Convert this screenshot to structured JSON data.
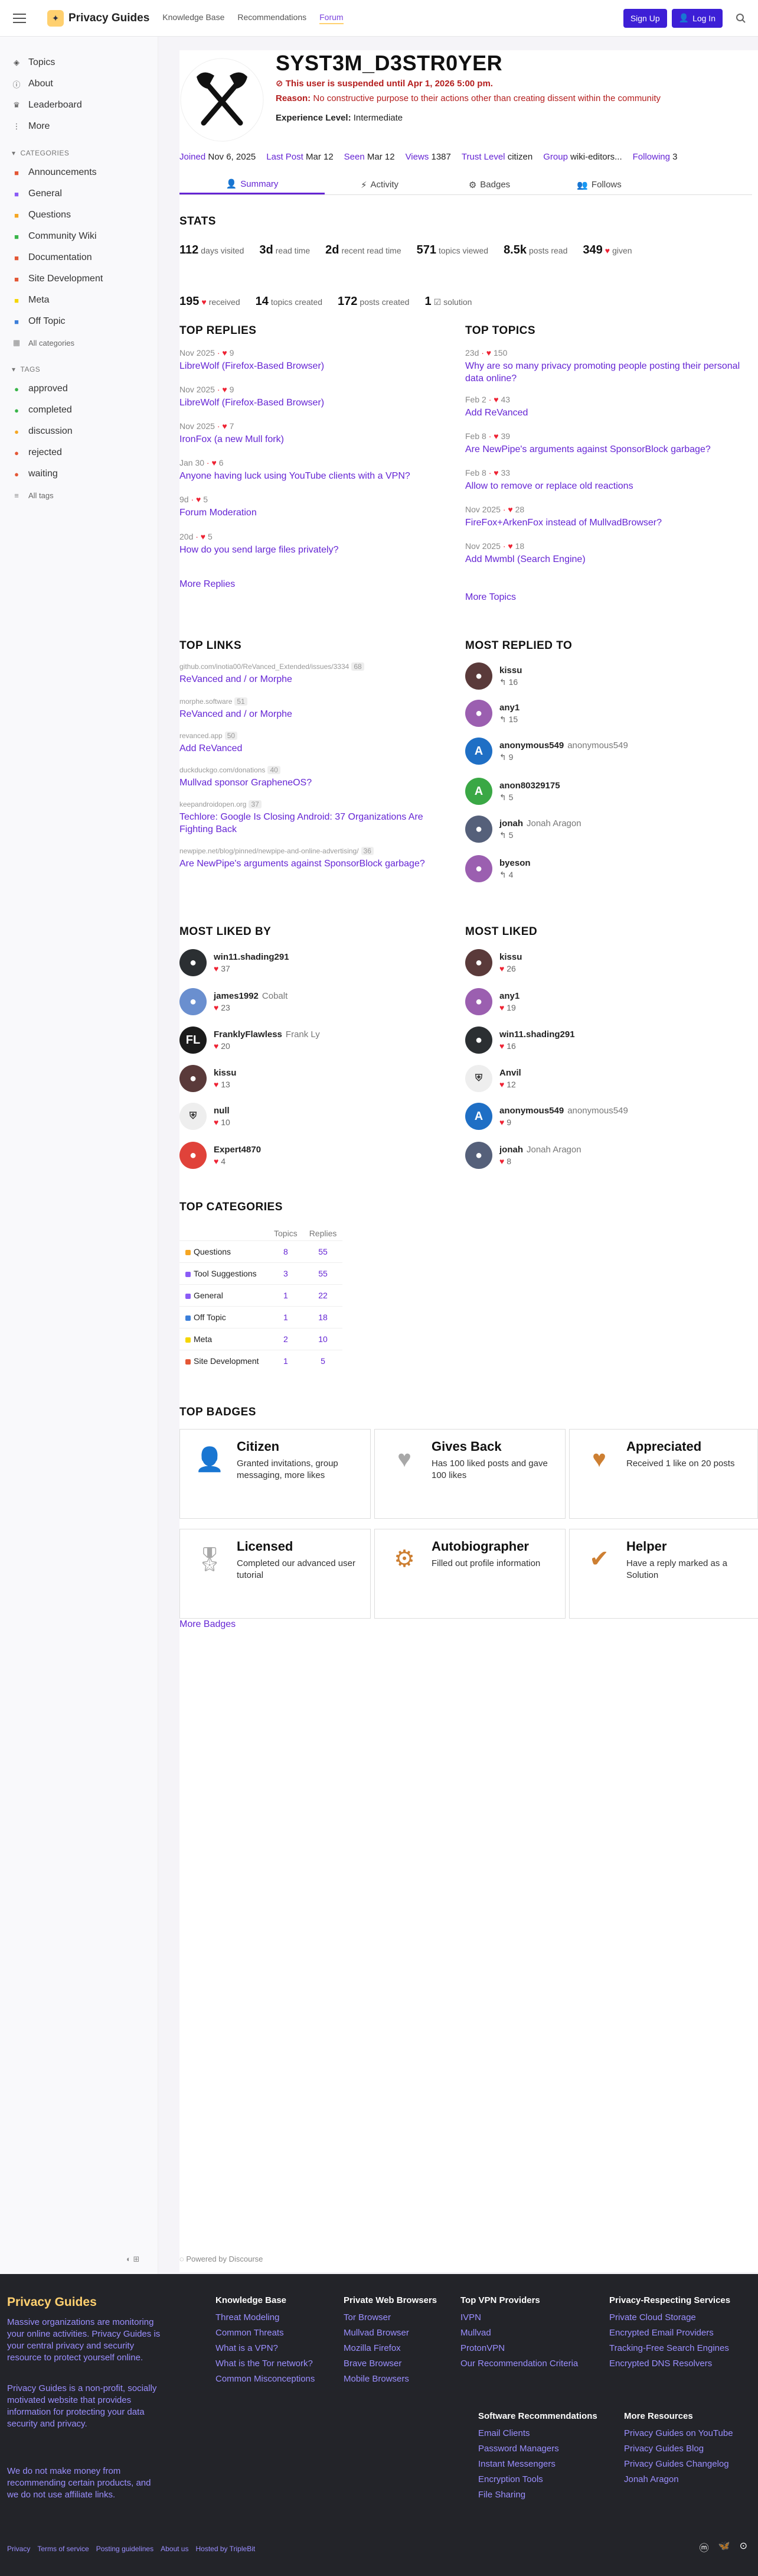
{
  "header": {
    "site_name": "Privacy Guides",
    "nav": [
      "Knowledge Base",
      "Recommendations",
      "Forum"
    ],
    "signup": "Sign Up",
    "login": "Log In"
  },
  "sidebar": {
    "items": [
      {
        "icon": "layer-icon",
        "label": "Topics"
      },
      {
        "icon": "info-icon",
        "label": "About"
      },
      {
        "icon": "trophy-icon",
        "label": "Leaderboard"
      },
      {
        "icon": "more-icon",
        "label": "More"
      }
    ],
    "categories_title": "CATEGORIES",
    "categories": [
      {
        "label": "Announcements",
        "color": "#e45735"
      },
      {
        "label": "General",
        "color": "#8b5cf6"
      },
      {
        "label": "Questions",
        "color": "#f5a623"
      },
      {
        "label": "Community Wiki",
        "color": "#3ab54a"
      },
      {
        "label": "Documentation",
        "color": "#e45735"
      },
      {
        "label": "Site Development",
        "color": "#e45735"
      },
      {
        "label": "Meta",
        "color": "#f5d600"
      },
      {
        "label": "Off Topic",
        "color": "#3c7fd9"
      },
      {
        "label": "All categories",
        "color": "#888888"
      }
    ],
    "tags_title": "TAGS",
    "tags": [
      {
        "label": "approved",
        "color": "#3ab54a"
      },
      {
        "label": "completed",
        "color": "#3ab54a"
      },
      {
        "label": "discussion",
        "color": "#f5a623"
      },
      {
        "label": "rejected",
        "color": "#e45735"
      },
      {
        "label": "waiting",
        "color": "#e45735"
      },
      {
        "label": "All tags",
        "color": "#888888"
      }
    ]
  },
  "profile": {
    "username": "SYST3M_D3STR0YER",
    "suspended": "This user is suspended until Apr 1, 2026 5:00 pm.",
    "reason_label": "Reason:",
    "reason": "No constructive purpose to their actions other than creating dissent within the community",
    "experience_label": "Experience Level:",
    "experience": "Intermediate",
    "meta": [
      {
        "k": "Joined",
        "v": "Nov 6, 2025"
      },
      {
        "k": "Last Post",
        "v": "Mar 12"
      },
      {
        "k": "Seen",
        "v": "Mar 12"
      },
      {
        "k": "Views",
        "v": "1387"
      },
      {
        "k": "Trust Level",
        "v": "citizen"
      },
      {
        "k": "Group",
        "v": "wiki-editors..."
      },
      {
        "k": "Following",
        "v": "3"
      }
    ]
  },
  "tabs": [
    "Summary",
    "Activity",
    "Badges",
    "Follows"
  ],
  "stats_title": "STATS",
  "stats": [
    {
      "n": "112",
      "l": "days visited"
    },
    {
      "n": "3d",
      "l": "read time"
    },
    {
      "n": "2d",
      "l": "recent read time"
    },
    {
      "n": "571",
      "l": "topics viewed"
    },
    {
      "n": "8.5k",
      "l": "posts read"
    },
    {
      "n": "349",
      "l": "given"
    },
    {
      "n": "195",
      "l": "received"
    },
    {
      "n": "14",
      "l": "topics created"
    },
    {
      "n": "172",
      "l": "posts created"
    },
    {
      "n": "1",
      "l": "solution"
    }
  ],
  "top_replies_title": "TOP REPLIES",
  "top_replies": [
    {
      "date": "Nov 2025",
      "likes": "9",
      "title": "LibreWolf (Firefox-Based Browser)"
    },
    {
      "date": "Nov 2025",
      "likes": "9",
      "title": "LibreWolf (Firefox-Based Browser)"
    },
    {
      "date": "Nov 2025",
      "likes": "7",
      "title": "IronFox (a new Mull fork)"
    },
    {
      "date": "Jan 30",
      "likes": "6",
      "title": "Anyone having luck using YouTube clients with a VPN?"
    },
    {
      "date": "9d",
      "likes": "5",
      "title": "Forum Moderation"
    },
    {
      "date": "20d",
      "likes": "5",
      "title": "How do you send large files privately?"
    }
  ],
  "more_replies": "More Replies",
  "top_topics_title": "TOP TOPICS",
  "top_topics": [
    {
      "date": "23d",
      "likes": "150",
      "title": "Why are so many privacy promoting people posting their personal data online?"
    },
    {
      "date": "Feb 2",
      "likes": "43",
      "title": "Add ReVanced"
    },
    {
      "date": "Feb 8",
      "likes": "39",
      "title": "Are NewPipe's arguments against SponsorBlock garbage?"
    },
    {
      "date": "Feb 8",
      "likes": "33",
      "title": "Allow to remove or replace old reactions"
    },
    {
      "date": "Nov 2025",
      "likes": "28",
      "title": "FireFox+ArkenFox instead of MullvadBrowser?"
    },
    {
      "date": "Nov 2025",
      "likes": "18",
      "title": "Add Mwmbl (Search Engine)"
    }
  ],
  "more_topics": "More Topics",
  "top_links_title": "TOP LINKS",
  "top_links": [
    {
      "domain": "github.com/inotia00/ReVanced_Extended/issues/3334",
      "count": "68",
      "title": "ReVanced and / or Morphe"
    },
    {
      "domain": "morphe.software",
      "count": "51",
      "title": "ReVanced and / or Morphe"
    },
    {
      "domain": "revanced.app",
      "count": "50",
      "title": "Add ReVanced"
    },
    {
      "domain": "duckduckgo.com/donations",
      "count": "40",
      "title": "Mullvad sponsor GrapheneOS?"
    },
    {
      "domain": "keepandroidopen.org",
      "count": "37",
      "title": "Techlore: Google Is Closing Android: 37 Organizations Are Fighting Back"
    },
    {
      "domain": "newpipe.net/blog/pinned/newpipe-and-online-advertising/",
      "count": "36",
      "title": "Are NewPipe's arguments against SponsorBlock garbage?"
    }
  ],
  "most_replied_title": "MOST REPLIED TO",
  "most_replied": [
    {
      "name": "kissu",
      "full": "",
      "count": "16",
      "color": "#5a3a3a",
      "init": ""
    },
    {
      "name": "any1",
      "full": "",
      "count": "15",
      "color": "#9b5fb0",
      "init": ""
    },
    {
      "name": "anonymous549",
      "full": "anonymous549",
      "count": "9",
      "color": "#1f6fc5",
      "init": "A"
    },
    {
      "name": "anon80329175",
      "full": "",
      "count": "5",
      "color": "#3aa845",
      "init": "A"
    },
    {
      "name": "jonah",
      "full": "Jonah Aragon",
      "count": "5",
      "color": "#55607a",
      "init": ""
    },
    {
      "name": "byeson",
      "full": "",
      "count": "4",
      "color": "#9b5fb0",
      "init": ""
    }
  ],
  "most_liked_by_title": "MOST LIKED BY",
  "most_liked_by": [
    {
      "name": "win11.shading291",
      "full": "",
      "count": "37",
      "color": "#2b2f32",
      "init": ""
    },
    {
      "name": "james1992",
      "full": "Cobalt",
      "count": "23",
      "color": "#6a8fcf",
      "init": ""
    },
    {
      "name": "FranklyFlawless",
      "full": "Frank Ly",
      "count": "20",
      "color": "#1b1b1b",
      "init": "FL"
    },
    {
      "name": "kissu",
      "full": "",
      "count": "13",
      "color": "#5a3a3a",
      "init": ""
    },
    {
      "name": "null",
      "full": "",
      "count": "10",
      "color": "#eeeeee",
      "init": ""
    },
    {
      "name": "Expert4870",
      "full": "",
      "count": "4",
      "color": "#e0423a",
      "init": ""
    }
  ],
  "most_liked_title": "MOST LIKED",
  "most_liked": [
    {
      "name": "kissu",
      "full": "",
      "count": "26",
      "color": "#5a3a3a",
      "init": ""
    },
    {
      "name": "any1",
      "full": "",
      "count": "19",
      "color": "#9b5fb0",
      "init": ""
    },
    {
      "name": "win11.shading291",
      "full": "",
      "count": "16",
      "color": "#2b2f32",
      "init": ""
    },
    {
      "name": "Anvil",
      "full": "",
      "count": "12",
      "color": "#eeeeee",
      "init": ""
    },
    {
      "name": "anonymous549",
      "full": "anonymous549",
      "count": "9",
      "color": "#1f6fc5",
      "init": "A"
    },
    {
      "name": "jonah",
      "full": "Jonah Aragon",
      "count": "8",
      "color": "#55607a",
      "init": ""
    }
  ],
  "top_categories_title": "TOP CATEGORIES",
  "top_categories_headers": [
    "Topics",
    "Replies"
  ],
  "top_categories": [
    {
      "name": "Questions",
      "topics": "8",
      "replies": "55",
      "color": "#f5a623"
    },
    {
      "name": "Tool Suggestions",
      "topics": "3",
      "replies": "55",
      "color": "#8b5cf6"
    },
    {
      "name": "General",
      "topics": "1",
      "replies": "22",
      "color": "#8b5cf6"
    },
    {
      "name": "Off Topic",
      "topics": "1",
      "replies": "18",
      "color": "#3c7fd9"
    },
    {
      "name": "Meta",
      "topics": "2",
      "replies": "10",
      "color": "#f5d600"
    },
    {
      "name": "Site Development",
      "topics": "1",
      "replies": "5",
      "color": "#e45735"
    }
  ],
  "top_badges_title": "TOP BADGES",
  "badges": [
    {
      "name": "Citizen",
      "desc": "Granted invitations, group messaging, more likes",
      "icon": "user-icon",
      "color": "#cd7f32"
    },
    {
      "name": "Gives Back",
      "desc": "Has 100 liked posts and gave 100 likes",
      "icon": "heart-icon",
      "color": "#a8a8a8"
    },
    {
      "name": "Appreciated",
      "desc": "Received 1 like on 20 posts",
      "icon": "heart-icon",
      "color": "#cd7f32"
    },
    {
      "name": "Licensed",
      "desc": "Completed our advanced user tutorial",
      "icon": "certificate-icon",
      "color": "#a8a8a8"
    },
    {
      "name": "Autobiographer",
      "desc": "Filled out profile information",
      "icon": "user-gear-icon",
      "color": "#cd7f32"
    },
    {
      "name": "Helper",
      "desc": "Have a reply marked as a Solution",
      "icon": "check-icon",
      "color": "#cd7f32"
    }
  ],
  "more_badges": "More Badges",
  "powered": "Powered by Discourse",
  "footer": {
    "title": "Privacy Guides",
    "p1": "Massive organizations are monitoring your online activities. Privacy Guides is your central privacy and security resource to protect yourself online.",
    "p2": "Privacy Guides is a non-profit, socially motivated website that provides information for protecting your data security and privacy.",
    "p3": "We do not make money from recommending certain products, and we do not use affiliate links.",
    "cols": [
      {
        "title": "Knowledge Base",
        "links": [
          "Threat Modeling",
          "Common Threats",
          "What is a VPN?",
          "What is the Tor network?",
          "Common Misconceptions"
        ]
      },
      {
        "title": "Private Web Browsers",
        "links": [
          "Tor Browser",
          "Mullvad Browser",
          "Mozilla Firefox",
          "Brave Browser",
          "Mobile Browsers"
        ]
      },
      {
        "title": "Top VPN Providers",
        "links": [
          "IVPN",
          "Mullvad",
          "ProtonVPN",
          "Our Recommendation Criteria"
        ]
      },
      {
        "title": "Privacy-Respecting Services",
        "links": [
          "Private Cloud Storage",
          "Encrypted Email Providers",
          "Tracking-Free Search Engines",
          "Encrypted DNS Resolvers"
        ]
      },
      {
        "title": "Software Recommendations",
        "links": [
          "Email Clients",
          "Password Managers",
          "Instant Messengers",
          "Encryption Tools",
          "File Sharing"
        ]
      },
      {
        "title": "More Resources",
        "links": [
          "Privacy Guides on YouTube",
          "Privacy Guides Blog",
          "Privacy Guides Changelog",
          "Jonah Aragon"
        ]
      }
    ],
    "bottom": [
      "Privacy",
      "Terms of service",
      "Posting guidelines",
      "About us",
      "Hosted by TripleBit"
    ]
  }
}
